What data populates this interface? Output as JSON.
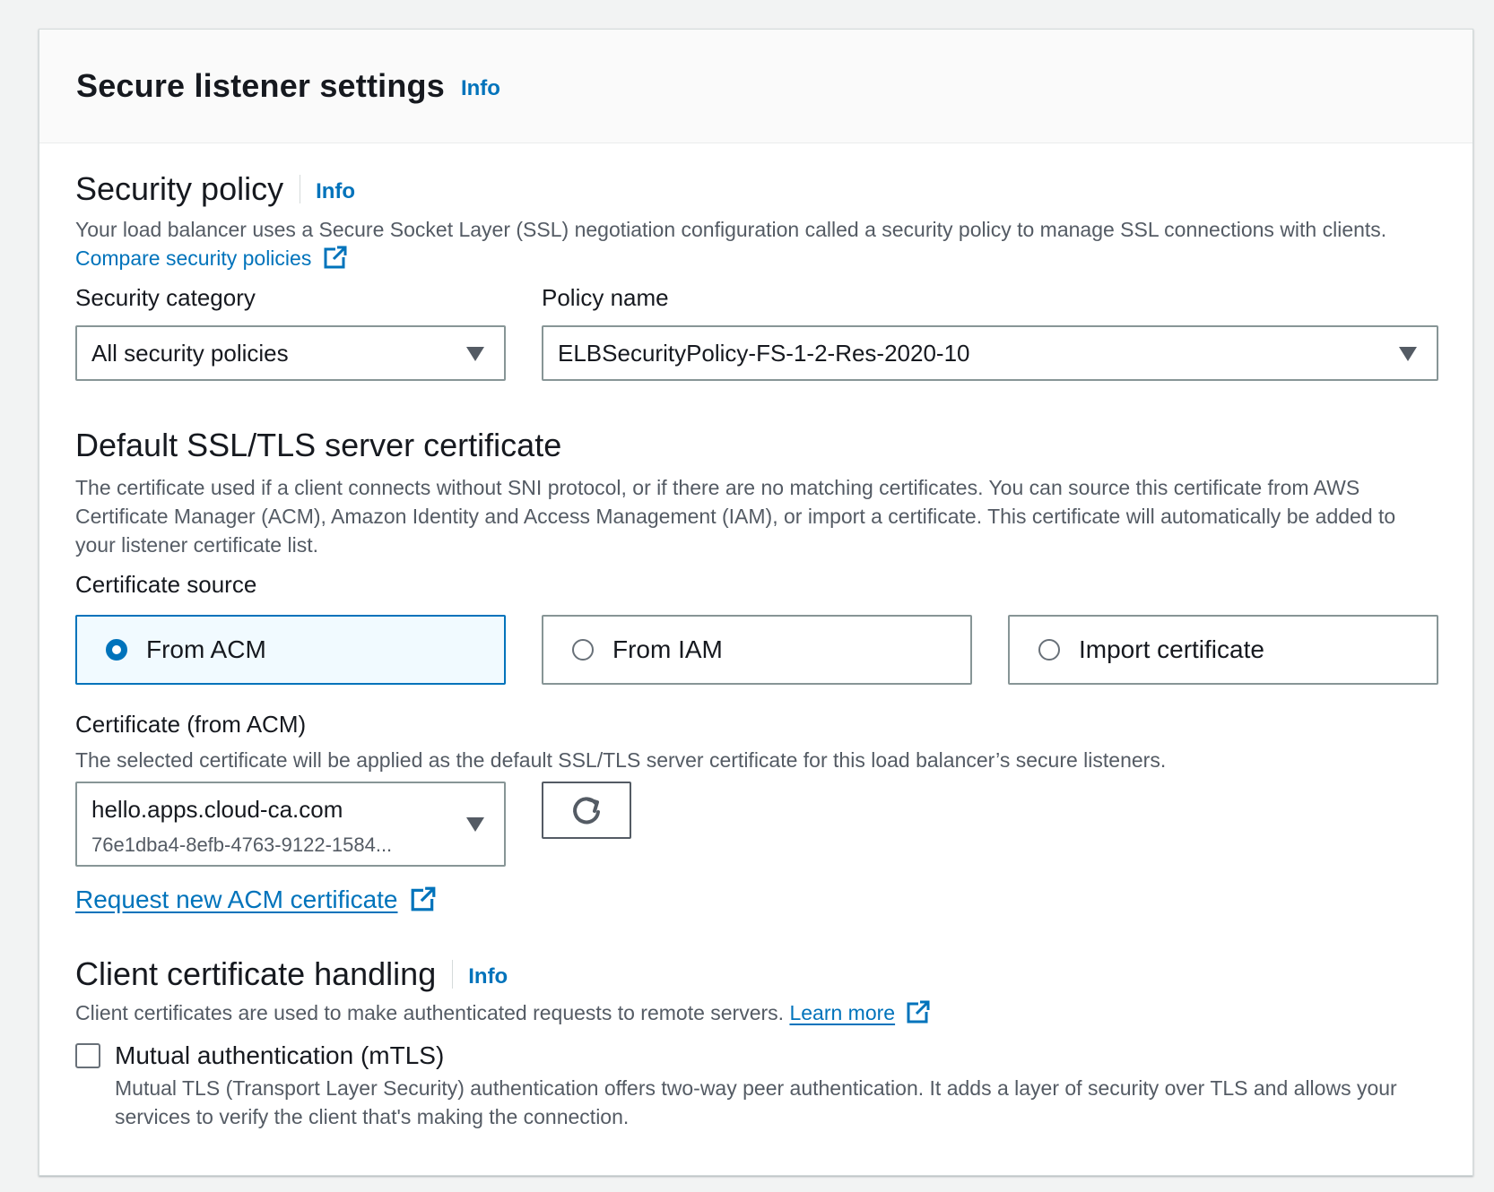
{
  "header": {
    "title": "Secure listener settings",
    "info": "Info"
  },
  "security_policy": {
    "title": "Security policy",
    "info": "Info",
    "description": "Your load balancer uses a Secure Socket Layer (SSL) negotiation configuration called a security policy to manage SSL connections with clients.",
    "compare_link": "Compare security policies",
    "category_label": "Security category",
    "category_value": "All security policies",
    "policy_label": "Policy name",
    "policy_value": "ELBSecurityPolicy-FS-1-2-Res-2020-10"
  },
  "default_cert": {
    "title": "Default SSL/TLS server certificate",
    "description": "The certificate used if a client connects without SNI protocol, or if there are no matching certificates. You can source this certificate from AWS Certificate Manager (ACM), Amazon Identity and Access Management (IAM), or import a certificate. This certificate will automatically be added to your listener certificate list.",
    "source_label": "Certificate source",
    "sources": [
      {
        "label": "From ACM",
        "selected": true
      },
      {
        "label": "From IAM",
        "selected": false
      },
      {
        "label": "Import certificate",
        "selected": false
      }
    ],
    "cert_label": "Certificate (from ACM)",
    "cert_description": "The selected certificate will be applied as the default SSL/TLS server certificate for this load balancer’s secure listeners.",
    "cert_value": "hello.apps.cloud-ca.com",
    "cert_id": "76e1dba4-8efb-4763-9122-1584...",
    "request_link": "Request new ACM certificate"
  },
  "client_cert": {
    "title": "Client certificate handling",
    "info": "Info",
    "description": "Client certificates are used to make authenticated requests to remote servers.",
    "learn_more": "Learn more",
    "mtls_label": "Mutual authentication (mTLS)",
    "mtls_checked": false,
    "mtls_description": "Mutual TLS (Transport Layer Security) authentication offers two-way peer authentication. It adds a layer of security over TLS and allows your services to verify the client that's making the connection."
  },
  "colors": {
    "link": "#0073bb",
    "selected_tile_bg": "#f1faff",
    "border": "#879596"
  },
  "icons": [
    "external-link-icon",
    "caret-down-icon",
    "refresh-icon"
  ]
}
